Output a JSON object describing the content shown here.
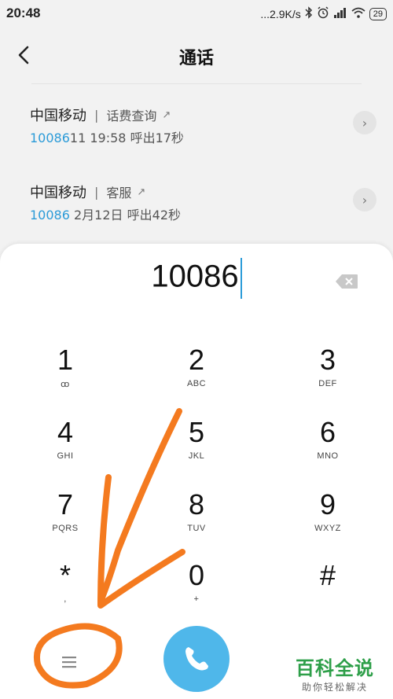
{
  "status_bar": {
    "time": "20:48",
    "net_speed": "...2.9K/s",
    "battery": "29",
    "icons": [
      "bluetooth-icon",
      "alarm-icon",
      "signal-icon",
      "wifi-icon",
      "battery-icon"
    ]
  },
  "header": {
    "title": "通话"
  },
  "calls": [
    {
      "name": "中国移动",
      "tag": "话费查询",
      "number_hl": "10086",
      "number_rest": "11",
      "time": "19:58",
      "direction": "呼出17秒"
    },
    {
      "name": "中国移动",
      "tag": "客服",
      "number_hl": "10086",
      "number_rest": "",
      "time": "2月12日",
      "direction": "呼出42秒"
    }
  ],
  "dialpad": {
    "input": "10086",
    "keys": [
      {
        "digit": "1",
        "letters": "ꝏ"
      },
      {
        "digit": "2",
        "letters": "ABC"
      },
      {
        "digit": "3",
        "letters": "DEF"
      },
      {
        "digit": "4",
        "letters": "GHI"
      },
      {
        "digit": "5",
        "letters": "JKL"
      },
      {
        "digit": "6",
        "letters": "MNO"
      },
      {
        "digit": "7",
        "letters": "PQRS"
      },
      {
        "digit": "8",
        "letters": "TUV"
      },
      {
        "digit": "9",
        "letters": "WXYZ"
      },
      {
        "digit": "*",
        "letters": ","
      },
      {
        "digit": "0",
        "letters": "+"
      },
      {
        "digit": "#",
        "letters": ""
      }
    ]
  },
  "colors": {
    "accent": "#2b9bd8",
    "call_button": "#4fb7ea",
    "annotation": "#f47a1f",
    "watermark": "#2e9f49"
  },
  "watermark": {
    "title": "百科全说",
    "subtitle": "助你轻松解决"
  }
}
